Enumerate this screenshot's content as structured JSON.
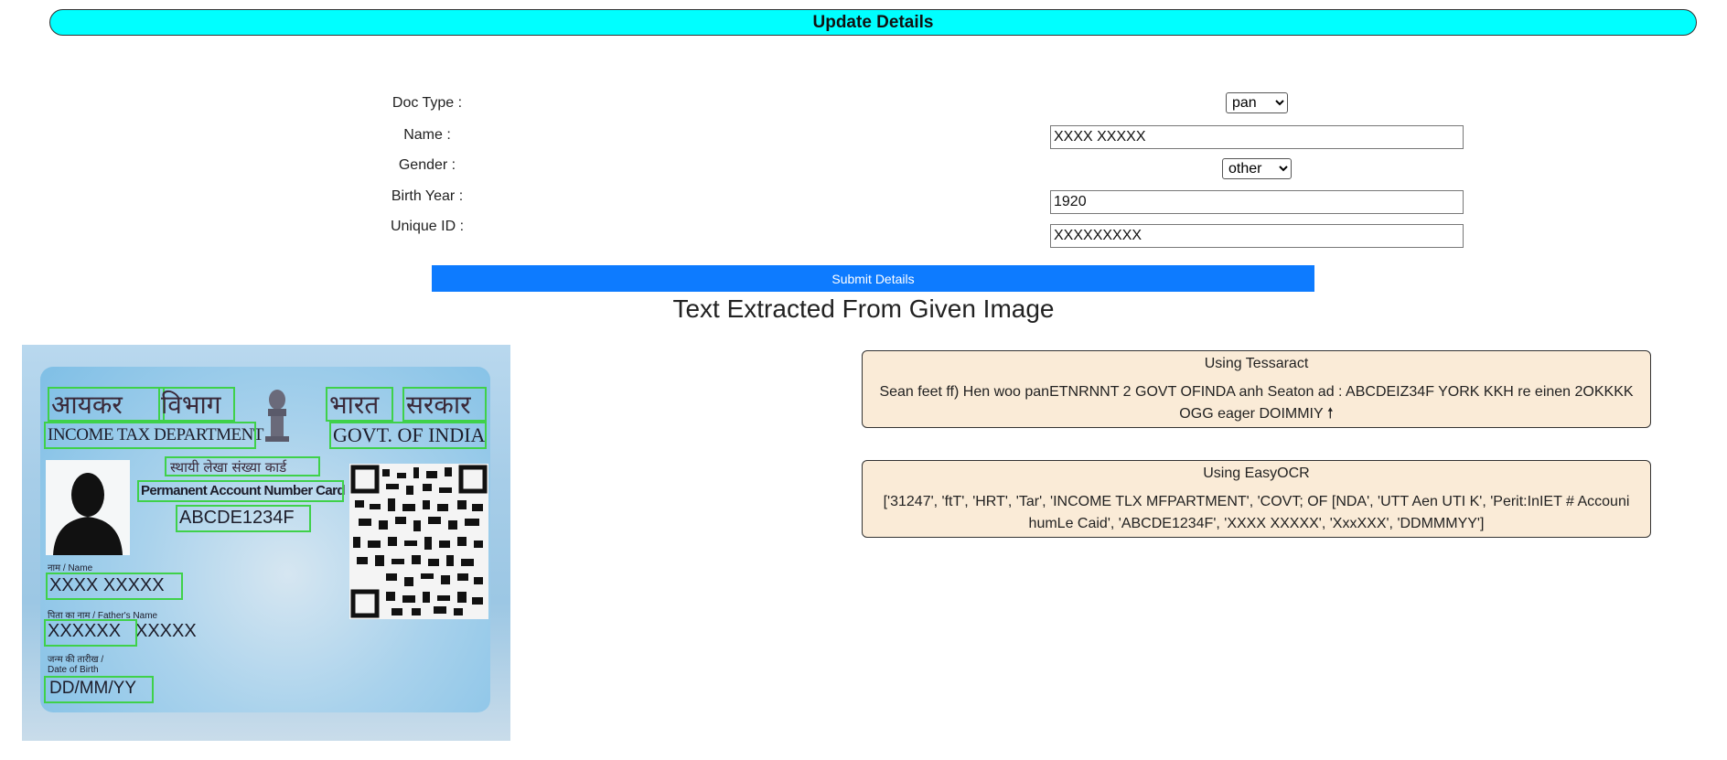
{
  "header": {
    "title": "Update Details"
  },
  "form": {
    "doc_type": {
      "label": "Doc Type :",
      "value": "pan"
    },
    "name": {
      "label": "Name :",
      "value": "XXXX XXXXX"
    },
    "gender": {
      "label": "Gender :",
      "value": "other"
    },
    "birth_year": {
      "label": "Birth Year :",
      "value": "1920"
    },
    "unique_id": {
      "label": "Unique ID :",
      "value": "XXXXXXXXX"
    },
    "submit_label": "Submit Details"
  },
  "extract": {
    "title": "Text Extracted From Given Image"
  },
  "card": {
    "hindi_left": "आयकर",
    "hindi_left2": "विभाग",
    "hindi_right": "भारत",
    "hindi_right2": "सरकार",
    "dept": "INCOME TAX DEPARTMENT",
    "govt": "GOVT. OF INDIA",
    "pan_hindi": "स्थायी लेखा संख्या कार्ड",
    "pan_english": "Permanent Account Number Card",
    "pan_number": "ABCDE1234F",
    "name_label": "नाम / Name",
    "name_value": "XXXX XXXXX",
    "father_label": "पिता का नाम / Father's Name",
    "father_value1": "XXXXXX",
    "father_value2": "XXXXX",
    "dob_hindi": "जन्म की तारीख /",
    "dob_label": "Date of Birth",
    "dob_value": "DD/MM/YY"
  },
  "results": {
    "tesseract": {
      "title": "Using Tessaract",
      "text": "Sean feet ff) Hen woo panETNRNNT 2 GOVT OFINDA anh Seaton ad : ABCDEIZ34F YORK KKH re einen 2OKKKK OGG eager DOIMMIY 🠕"
    },
    "easyocr": {
      "title": "Using EasyOCR",
      "text": "['31247', 'ftT', 'HRT', 'Tar', 'INCOME TLX MFPARTMENT', 'COVT; OF [NDA', 'UTT Aen UTI K', 'Perit:InIET # Accouni humLe Caid', 'ABCDE1234F', 'XXXX XXXXX', 'XxxXXX', 'DDMMMYY']"
    }
  }
}
